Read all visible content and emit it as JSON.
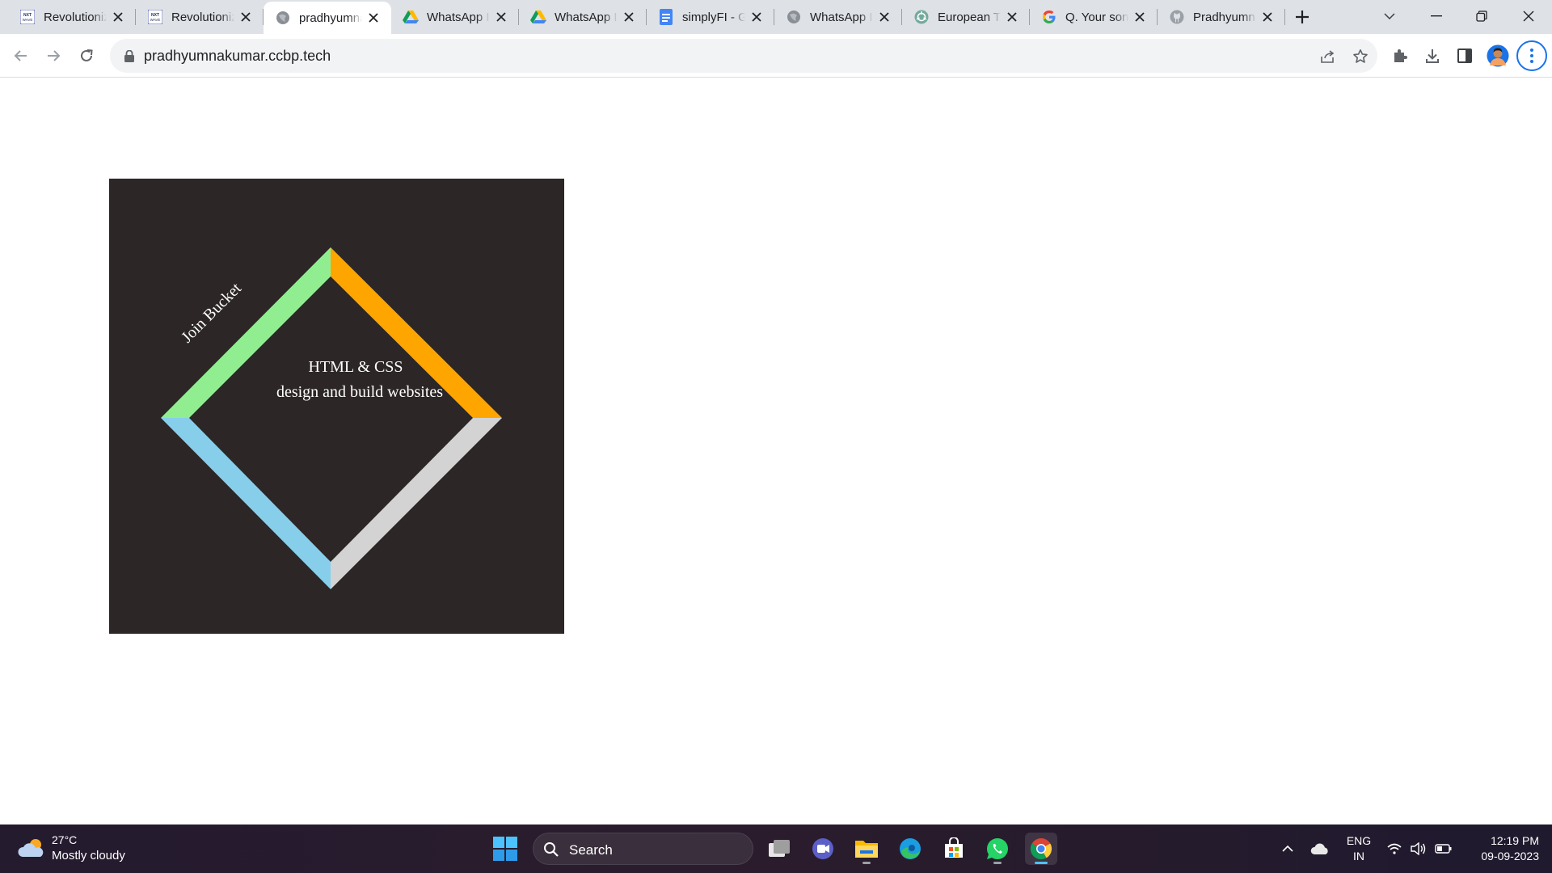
{
  "browser": {
    "tabs": [
      {
        "title": "Revolutionizing",
        "icon": "nxtwave-icon"
      },
      {
        "title": "Revolutionizing",
        "icon": "nxtwave-icon"
      },
      {
        "title": "pradhyumnakumar",
        "icon": "globe-icon"
      },
      {
        "title": "WhatsApp Image",
        "icon": "google-drive-icon"
      },
      {
        "title": "WhatsApp Image",
        "icon": "google-drive-icon"
      },
      {
        "title": "simplyFI - Google",
        "icon": "google-docs-icon"
      },
      {
        "title": "WhatsApp Image",
        "icon": "globe-icon"
      },
      {
        "title": "European Travel",
        "icon": "chatgpt-icon"
      },
      {
        "title": "Q. Your son",
        "icon": "google-icon"
      },
      {
        "title": "Pradhyumna",
        "icon": "github-icon"
      }
    ],
    "active_tab_index": 2,
    "url": "pradhyumnakumar.ccbp.tech"
  },
  "page": {
    "card": {
      "rotated_label": "Join Bucket",
      "title_line1": "HTML & CSS",
      "title_line2": "design and build websites",
      "colors": {
        "background": "#2c2626",
        "top_left": "#90ee90",
        "top_right": "#ffa500",
        "bottom_right": "#d3d3d3",
        "bottom_left": "#87ceeb"
      }
    }
  },
  "taskbar": {
    "weather": {
      "temperature": "27°C",
      "condition": "Mostly cloudy"
    },
    "search_label": "Search",
    "apps": [
      "task-view-icon",
      "teams-chat-icon",
      "file-explorer-icon",
      "edge-icon",
      "microsoft-store-icon",
      "whatsapp-icon",
      "chrome-icon"
    ],
    "language": {
      "line1": "ENG",
      "line2": "IN"
    },
    "time": "12:19 PM",
    "date": "09-09-2023"
  }
}
